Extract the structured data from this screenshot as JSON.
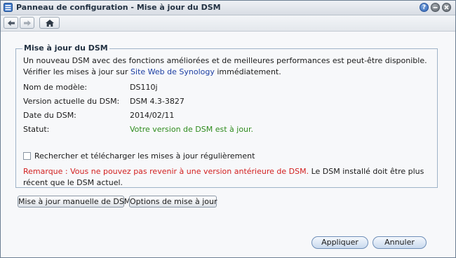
{
  "window": {
    "title": "Panneau de configuration - Mise à jour du DSM",
    "help_glyph": "?"
  },
  "section": {
    "legend": "Mise à jour du DSM",
    "intro_part1": "Un nouveau DSM avec des fonctions améliorées et de meilleures performances est peut-être disponible. Vérifier les mises à jour sur ",
    "intro_link": "Site Web de Synology",
    "intro_part2": " immédiatement."
  },
  "info": {
    "model_label": "Nom de modèle:",
    "model_value": "DS110j",
    "version_label": "Version actuelle du DSM:",
    "version_value": "DSM 4.3-3827",
    "date_label": "Date du DSM:",
    "date_value": "2014/02/11",
    "status_label": "Statut:",
    "status_value": "Votre version de DSM est à jour."
  },
  "auto_update": {
    "label": "Rechercher et télécharger les mises à jour régulièrement",
    "checked": false
  },
  "remark": {
    "red": "Remarque : Vous ne pouvez pas revenir à une version antérieure de DSM.",
    "rest": " Le DSM installé doit être plus récent que le DSM actuel."
  },
  "buttons": {
    "manual_update": "Mise à jour manuelle de DSM",
    "update_options": "Options de mise à jour",
    "apply": "Appliquer",
    "cancel": "Annuler"
  },
  "colors": {
    "status_ok": "#2e8b1d",
    "remark_red": "#d21f1f",
    "link_blue": "#1d3fa3"
  },
  "icons": {
    "app": "control-panel-icon",
    "back": "arrow-left-icon",
    "forward": "arrow-right-icon",
    "home": "home-icon"
  }
}
